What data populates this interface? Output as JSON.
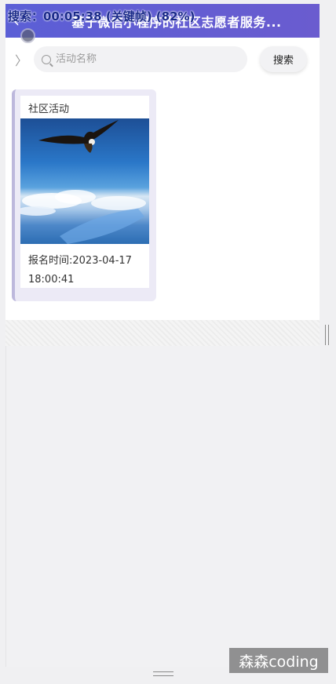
{
  "header": {
    "title": "基于微信小程序的社区志愿者服务...",
    "back_icon": "back-arrow-icon"
  },
  "recording_overlay": "搜索：00:05:38 (关键帧) (82%)",
  "search": {
    "placeholder": "活动名称",
    "value": "",
    "button_label": "搜索"
  },
  "activities": [
    {
      "category": "社区活动",
      "signup_time_line1": "报名时间:2023-04-17",
      "signup_time_line2": "18:00:41"
    }
  ],
  "watermark": "森森coding",
  "colors": {
    "header": "#5b5fd6",
    "card_bg": "#eceaf6"
  }
}
